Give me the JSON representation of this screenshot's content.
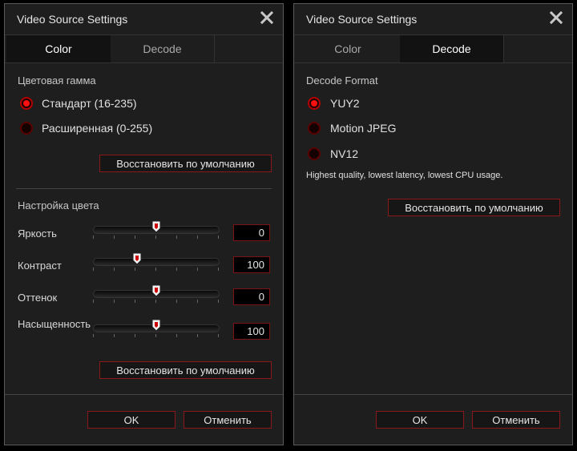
{
  "dialog_color": {
    "title": "Video Source Settings",
    "tabs": [
      {
        "label": "Color",
        "active": true
      },
      {
        "label": "Decode",
        "active": false
      }
    ],
    "gamut_label": "Цветовая гамма",
    "gamut_options": [
      {
        "label": "Стандарт (16-235)",
        "checked": true
      },
      {
        "label": "Расширенная (0-255)",
        "checked": false
      }
    ],
    "restore_label": "Восстановить по умолчанию",
    "color_adjust_label": "Настройка цвета",
    "sliders": [
      {
        "label": "Яркость",
        "value": "0",
        "fraction": 0.5
      },
      {
        "label": "Контраст",
        "value": "100",
        "fraction": 0.35
      },
      {
        "label": "Оттенок",
        "value": "0",
        "fraction": 0.5
      },
      {
        "label": "Насыщенность",
        "value": "100",
        "fraction": 0.5
      }
    ],
    "ok_label": "OK",
    "cancel_label": "Отменить"
  },
  "dialog_decode": {
    "title": "Video Source Settings",
    "tabs": [
      {
        "label": "Color",
        "active": false
      },
      {
        "label": "Decode",
        "active": true
      }
    ],
    "format_label": "Decode Format",
    "format_options": [
      {
        "label": "YUY2",
        "checked": true
      },
      {
        "label": "Motion JPEG",
        "checked": false
      },
      {
        "label": "NV12",
        "checked": false
      }
    ],
    "description": "Highest quality, lowest latency, lowest CPU usage.",
    "restore_label": "Восстановить по умолчанию",
    "ok_label": "OK",
    "cancel_label": "Отменить"
  },
  "icons": {
    "close": "close-icon",
    "radio": "radio-button",
    "slider_thumb": "slider-thumb-icon"
  },
  "colors": {
    "accent": "#ff1010",
    "border_accent": "#8a1a1a",
    "background": "#1e1e1e"
  }
}
